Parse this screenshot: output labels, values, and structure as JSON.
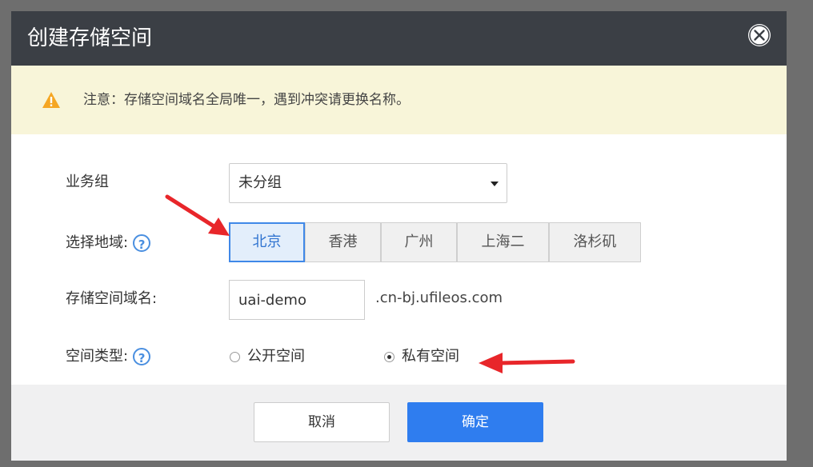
{
  "dialog": {
    "title": "创建存储空间"
  },
  "notice": {
    "text": "注意：存储空间域名全局唯一，遇到冲突请更换名称。"
  },
  "form": {
    "business_group": {
      "label": "业务组",
      "value": "未分组"
    },
    "region": {
      "label": "选择地域:",
      "help": "?",
      "options": [
        "北京",
        "香港",
        "广州",
        "上海二",
        "洛杉矶"
      ],
      "selected": "北京"
    },
    "domain": {
      "label": "存储空间域名:",
      "value": "uai-demo",
      "suffix": ".cn-bj.ufileos.com"
    },
    "space_type": {
      "label": "空间类型:",
      "help": "?",
      "options": [
        "公开空间",
        "私有空间"
      ],
      "selected": "私有空间"
    }
  },
  "footer": {
    "cancel_label": "取消",
    "ok_label": "确定"
  },
  "colors": {
    "header_bg": "#3b3f45",
    "notice_bg": "#f8f5d9",
    "warning": "#f5a623",
    "primary": "#2f7def",
    "annotation_arrow": "#e8262a"
  },
  "icons": {
    "close": "close-icon",
    "warning": "warning-icon",
    "help": "help-icon",
    "dropdown": "caret-down-icon"
  }
}
